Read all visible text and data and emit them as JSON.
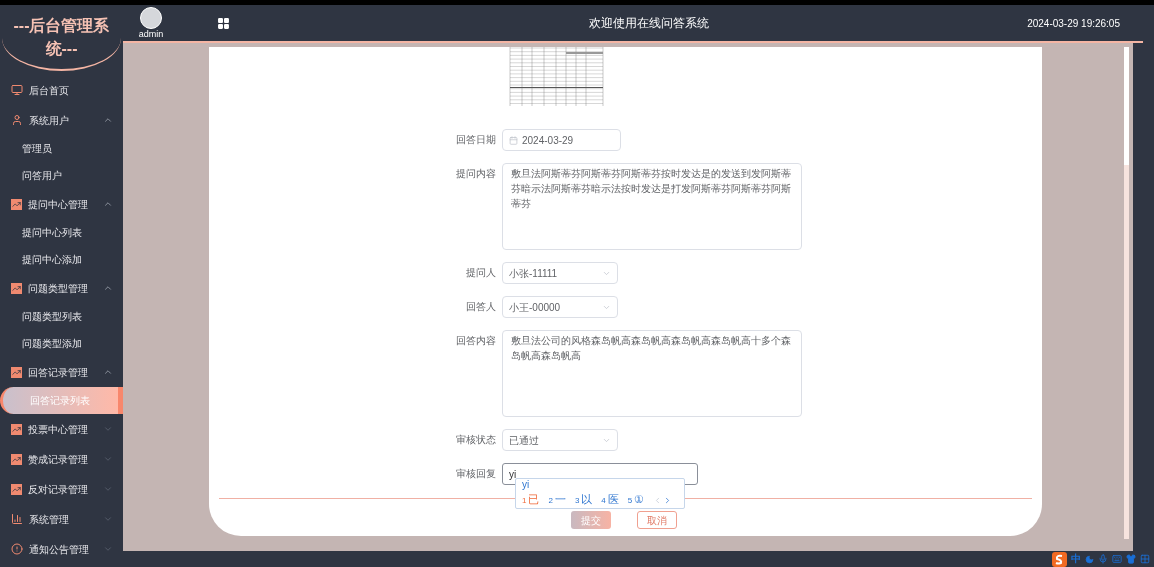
{
  "logo": {
    "title": "---后台管理系统---"
  },
  "header": {
    "user": "admin",
    "title": "欢迎使用在线问答系统",
    "time": "2024-03-29 19:26:05"
  },
  "sidebar": {
    "items": [
      {
        "label": "后台首页",
        "kind": "monitor"
      },
      {
        "label": "系统用户",
        "kind": "user",
        "expanded": true,
        "children": [
          {
            "label": "管理员",
            "selected": false
          },
          {
            "label": "问答用户",
            "selected": false
          }
        ]
      },
      {
        "label": "提问中心管理",
        "kind": "chart",
        "expanded": true,
        "children": [
          {
            "label": "提问中心列表",
            "selected": false
          },
          {
            "label": "提问中心添加",
            "selected": false
          }
        ]
      },
      {
        "label": "问题类型管理",
        "kind": "chart",
        "expanded": true,
        "children": [
          {
            "label": "问题类型列表",
            "selected": false
          },
          {
            "label": "问题类型添加",
            "selected": false
          }
        ]
      },
      {
        "label": "回答记录管理",
        "kind": "chart",
        "expanded": true,
        "children": [
          {
            "label": "回答记录列表",
            "selected": true
          }
        ]
      },
      {
        "label": "投票中心管理",
        "kind": "chart",
        "expanded": false
      },
      {
        "label": "赞成记录管理",
        "kind": "chart",
        "expanded": false
      },
      {
        "label": "反对记录管理",
        "kind": "chart",
        "expanded": false
      },
      {
        "label": "系统管理",
        "kind": "bars",
        "expanded": false
      },
      {
        "label": "通知公告管理",
        "kind": "alert",
        "expanded": false
      }
    ]
  },
  "form": {
    "fields": [
      {
        "kind": "date",
        "label": "回答日期",
        "value": "2024-03-29"
      },
      {
        "kind": "textarea",
        "label": "提问内容",
        "value": "敷旦法阿斯蒂芬阿斯蒂芬阿斯蒂芬按时发达是的发送到发阿斯蒂芬暗示法阿斯蒂芬暗示法按时发达是打发阿斯蒂芬阿斯蒂芬阿斯蒂芬"
      },
      {
        "kind": "select",
        "label": "提问人",
        "value": "小张-11111"
      },
      {
        "kind": "select",
        "label": "回答人",
        "value": "小王-00000"
      },
      {
        "kind": "textarea",
        "label": "回答内容",
        "value": "敷旦法公司的风格森岛帆高森岛帆高森岛帆高森岛帆高十多个森岛帆高森岛帆高"
      },
      {
        "kind": "select",
        "label": "审核状态",
        "value": "已通过"
      },
      {
        "kind": "input",
        "label": "审核回复",
        "value": "yi"
      }
    ],
    "buttons": [
      {
        "kind": "primary",
        "label": "提交"
      },
      {
        "kind": "outline",
        "label": "取消"
      }
    ]
  },
  "ime": {
    "composition": "yi",
    "candidates": [
      {
        "index": "1",
        "text": "已",
        "selected": true
      },
      {
        "index": "2",
        "text": "一",
        "selected": false
      },
      {
        "index": "3",
        "text": "以",
        "selected": false
      },
      {
        "index": "4",
        "text": "医",
        "selected": false
      },
      {
        "index": "5",
        "text": "①",
        "selected": false
      }
    ]
  },
  "tray": {
    "mode": "中"
  }
}
